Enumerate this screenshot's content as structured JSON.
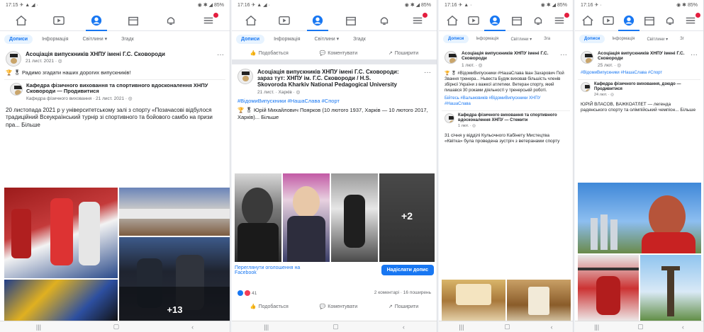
{
  "panel1": {
    "status_left": "17:15 ✈ ▲ ◢ ·",
    "status_right": "◉ ✱ ◢ 85%",
    "tabs": [
      "Допиcи",
      "Інформація",
      "Світлини ▾",
      "Згадк"
    ],
    "post": {
      "author": "Асоціація випускників ХНПУ імені Г.С. Сковороди",
      "meta": "21 лист. 2021 · ◎",
      "text": "🏆 🎖 Радимо згадати наших дорогих випускників!",
      "shared_author": "Кафедра фізичного виховання та спортивного вдосконалення ХНПУ Сковороди — Продивитися",
      "shared_meta": "Кафедра фізичного виховання · 21 лист. 2021 · ◎",
      "body": "20 листопада 2021 р у університетському залі з спорту «Позачасові відбулося традиційний Всеукраїнський турнір зі спортивного та бойового самбо на призи пра... Більше"
    },
    "overlay_count": "+13"
  },
  "panel2": {
    "status_left": "17:16 ✈ ▲ ◢ ·",
    "status_right": "◉ ✱ ◢ 85%",
    "tabs": [
      "Допиcи",
      "Інформація",
      "Світлини ▾",
      "Згадк"
    ],
    "actions": [
      "Подобається",
      "Коментувати",
      "Поширити"
    ],
    "post": {
      "author": "Асоціація випускників ХНПУ імені Г.С. Сковороди: зараз тут: ХНПУ ім. Г.С. Сковороди / H.S. Skovoroda Kharkiv National Pedagogical University",
      "meta": "21 лист. · Харків · ◎",
      "hashtags": "#ВідомиВипускники #НашаСлава #Спорт",
      "text": "🏆 🎖 Юрій Михайлович Поярков (10 лютого 1937, Харків — 10 лютого 2017, Харків)... Більше",
      "more_count": "+2",
      "cta_text": "Переглянути оголошення на Facebook",
      "cta_button": "Надіслати допис",
      "reactions_count": "41",
      "comments": "2 коментарі · 16 поширень"
    },
    "bottom_actions": [
      "Подобається",
      "Коментувати",
      "Поширити"
    ]
  },
  "panel3": {
    "status_left": "17:16 ✈ ▲ ·",
    "status_right": "◉ ✱ ◢ 85%",
    "tabs": [
      "Допиcи",
      "Інформація",
      "Світлини ▾",
      "Зга"
    ],
    "post": {
      "author": "Асоціація випускників ХНПУ імені Г.С. Сковороди",
      "meta": "1 лют. · ◎",
      "text": "🏆 🎖 #ВідомиВипускники #НашаСлава Іван Захарович Пой Звання тренера... Ньвеста Будяк виховав більшість членів збірної України з важкої атлетики. Ветеран спорту, який пишався 30 роками діяльності у тренерській роботі.",
      "hashtags": "Бійтесь #Вальмовиків #ВідомиВипускники ХНПУ #НашаСлава",
      "shared_author": "Кафедра фізичного виховання та спортивного вдосконалення ХНПУ — Стежити",
      "shared_meta": "1 лют. · ◎",
      "shared_text": "31 січня у відділі Кульочного Кабінету Мистецтва «Квітка» була проведена зустріч з ветеранами спорту"
    }
  },
  "panel4": {
    "status_left": "17:16 ✈ ·",
    "status_right": "◉ ✱ 85%",
    "tabs": [
      "Допиcи",
      "Інформація",
      "Світлини ▾",
      "Зг"
    ],
    "post": {
      "author": "Асоціація випускників ХНПУ імені Г.С. Сковороди",
      "meta": "25 лют. · ◎",
      "hashtags": "#ВідомиВипускники #НашаСлава #Спорт",
      "shared_author": "Кафедра фізичного виховання, дзюдо — Продивитися",
      "shared_meta": "24 лют. · ◎",
      "text": "ЮРІЙ ВЛАСОВ, ВАЖКОАТЛЕТ — легенда радянського спорту та олімпійський чемпіон... Більше"
    }
  },
  "colors": {
    "fb_blue": "#1877f2",
    "badge_red": "#e41e3f",
    "meta_gray": "#65676b"
  }
}
